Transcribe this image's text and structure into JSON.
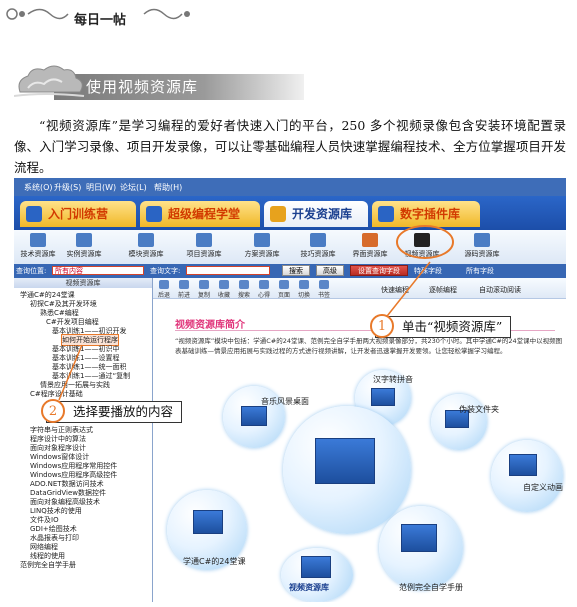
{
  "header": {
    "title": "每日一帖"
  },
  "section": {
    "title": "使用视频资源库"
  },
  "paragraph": "“视频资源库”是学习编程的爱好者快速入门的平台，250 多个视频录像包含安装环境配置录像、入门学习录像、项目开发录像，可以让零基础编程人员快速掌握编程技术、全方位掌握项目开发流程。",
  "app": {
    "menu": [
      "系统(O)",
      "升级(S)",
      "明日(W)",
      "论坛(L)",
      "帮助(H)"
    ],
    "tabs": [
      "入门训练营",
      "超级编程学堂",
      "开发资源库",
      "数字插件库"
    ],
    "toolbar": [
      "技术资源库",
      "实例资源库",
      "模块资源库",
      "项目资源库",
      "方案资源库",
      "技巧资源库",
      "界面资源库",
      "视频资源库",
      "源码资源库"
    ],
    "search": {
      "position_label": "查询位置:",
      "position_value": "所有内容",
      "text_label": "查询文字:",
      "search_btn": "搜索",
      "advanced_btn": "高级",
      "query_field_btn": "设置查询字段",
      "radio_specific": "特殊字段",
      "radio_all": "所有字段"
    },
    "left": {
      "header": "视频资源库",
      "nodes": [
        "学通C#的24堂课",
        "初探C#及其开发环境",
        "熟悉C#编程",
        "C#开发项目编程",
        "基本训练1——初识开发",
        "如何开始运行程序",
        "基本训练1——初识中",
        "基本训练1——设置程",
        "基本训练1——统一面积",
        "基本训练1——通过“复制",
        "情景应用一拓展与实践",
        "C#程序设计基础",
        "字符串与正则表达式",
        "程序设计中的算法",
        "面向对象程序设计",
        "Windows窗体设计",
        "Windows应用程序常用控件",
        "Windows应用程序高级控件",
        "ADO.NET数据访问技术",
        "DataGridView数据控件",
        "面向对象编程高级技术",
        "LINQ技术的使用",
        "文件及IO",
        "GDI+绘图技术",
        "水晶报表与打印",
        "网络编程",
        "线程的使用",
        "范例完全自学手册"
      ]
    },
    "right_toolbar": [
      "后退",
      "前进",
      "复制",
      "收藏",
      "搜索",
      "心得",
      "页面",
      "切换",
      "书签"
    ],
    "right_options": [
      "快速编程",
      "逐帧编程",
      "自动滚动阅读"
    ],
    "content": {
      "heading": "视频资源库简介",
      "desc": "“视频资源库”模块中包括：学通C#的24堂课、范例完全自学手册两大视频录像部分，共230个小时。其中学通C#的24堂课中以视频图表基础训练—情景应用拓展与实践过程的方式进行视频讲解，让开发者迅速掌握开发要领。让您轻松掌握学习编程。",
      "bubbles": [
        "音乐风景桌面",
        "汉字转拼音",
        "伪装文件夹",
        "自定义动画",
        "学通C#的24堂课",
        "范例完全自学手册",
        "视频资源库"
      ]
    }
  },
  "callouts": [
    {
      "num": "1",
      "text": "单击“视频资源库”"
    },
    {
      "num": "2",
      "text": "选择要播放的内容"
    }
  ],
  "colors": {
    "accent_orange": "#e8792a",
    "tab_blue": "#2b66c8",
    "pink_heading": "#e0347a"
  }
}
